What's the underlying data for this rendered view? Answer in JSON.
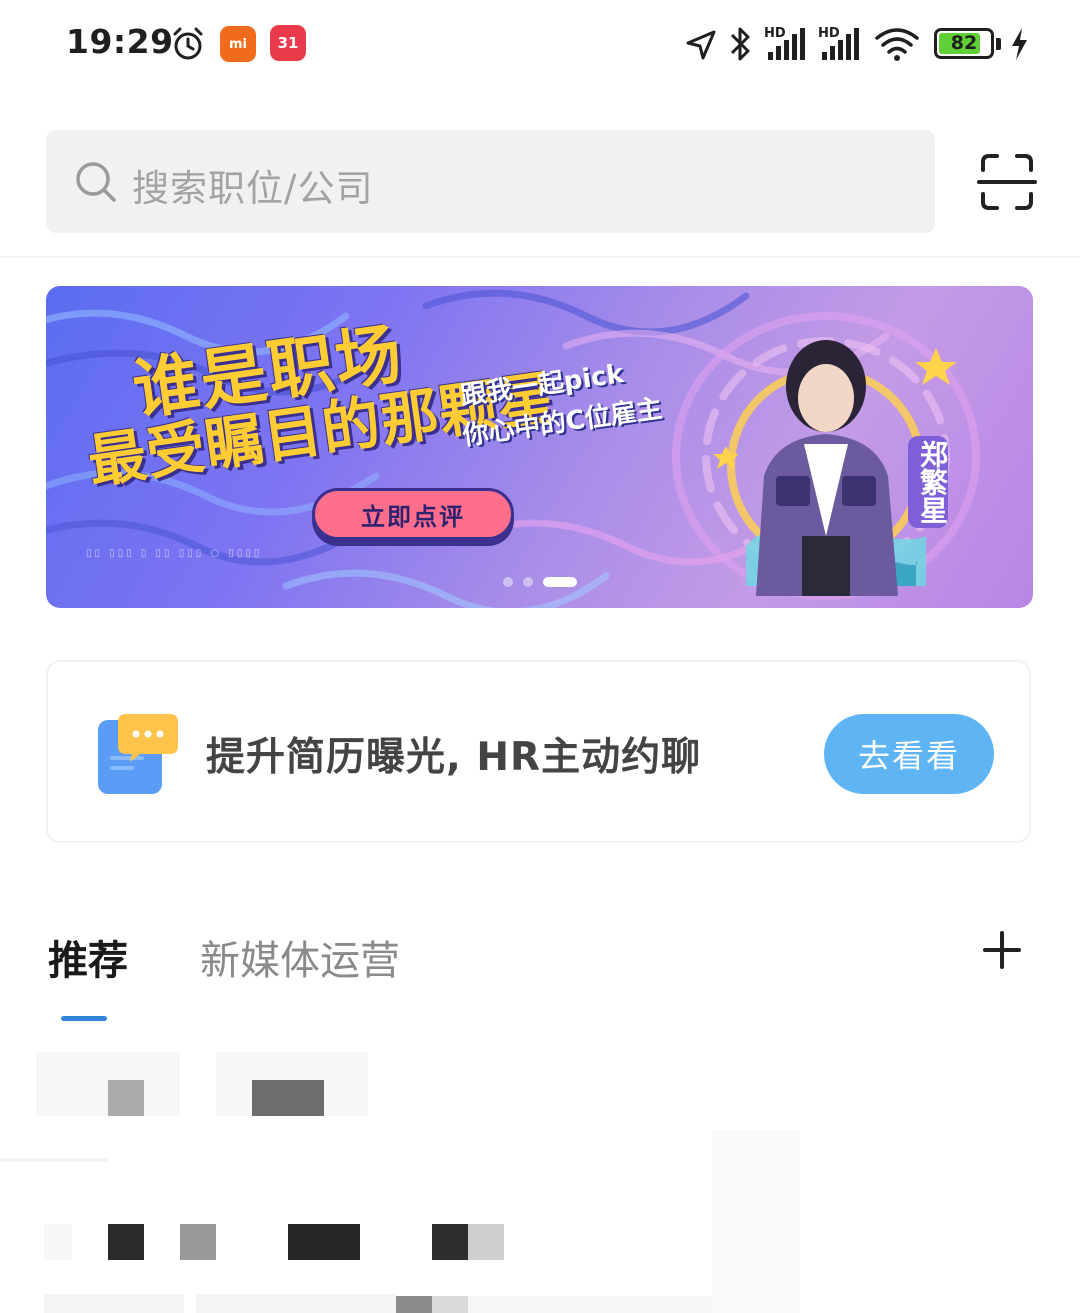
{
  "status_bar": {
    "time": "19:29",
    "battery": "82",
    "battery_level": 0.82,
    "icons": [
      "alarm-icon",
      "xiaomi-app-icon",
      "app-31-icon",
      "location-icon",
      "bluetooth-icon",
      "signal-hd-icon",
      "signal-hd-icon",
      "wifi-icon",
      "battery-icon",
      "charging-icon"
    ],
    "app_mi_label": "mi",
    "app_31_label": "31"
  },
  "search": {
    "placeholder": "搜索职位/公司"
  },
  "banner": {
    "title_line1": "谁是职场",
    "title_line2": "最受瞩目的那颗星",
    "sub_line1": "跟我一起pick",
    "sub_line2": "你心中的C位雇主",
    "cta": "立即点评",
    "star_name": "郑繁星",
    "slide_count": 3,
    "active_slide": 2
  },
  "promo": {
    "text": "提升简历曝光, HR主动约聊",
    "button": "去看看"
  },
  "tabs": {
    "items": [
      "推荐",
      "新媒体运营"
    ],
    "active": "推荐"
  },
  "colors": {
    "accent": "#2f86d9",
    "promo_button": "#5fb5f4",
    "banner_yellow": "#ffcc33",
    "banner_cta": "#ff6e8a"
  }
}
